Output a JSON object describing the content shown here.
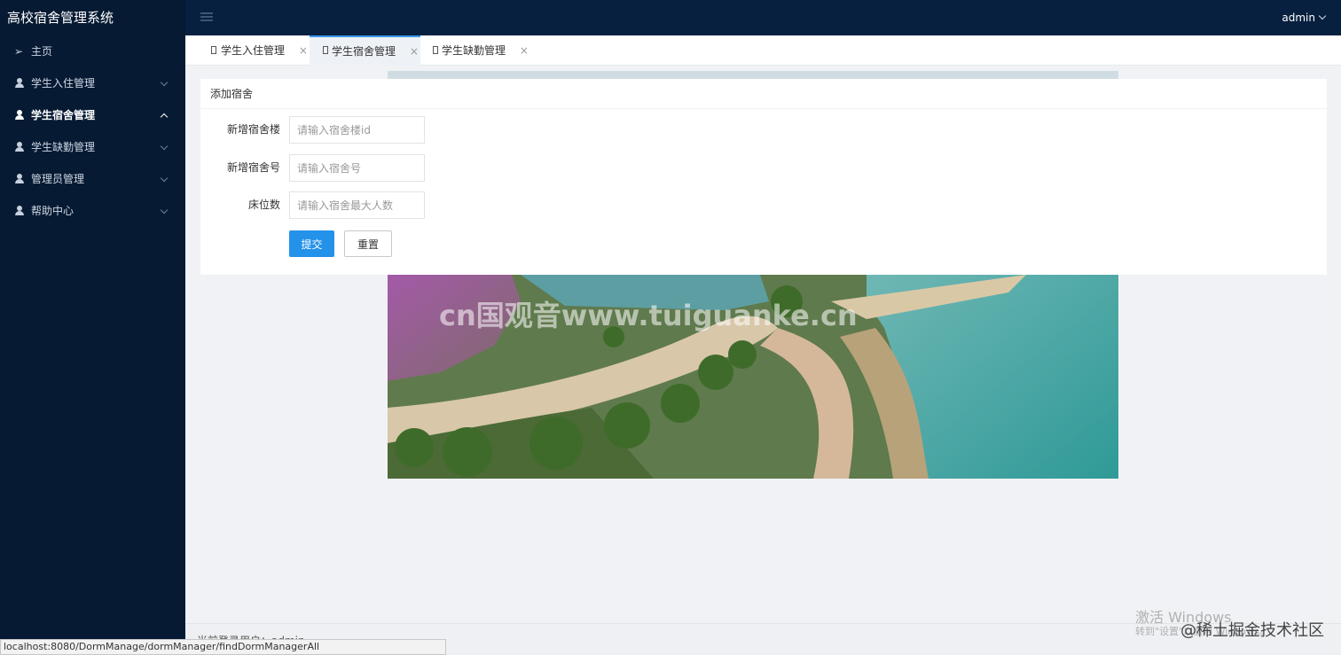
{
  "app": {
    "title": "高校宿舍管理系统"
  },
  "header": {
    "user": "admin"
  },
  "sidebar": {
    "items": [
      {
        "label": "主页",
        "icon": "paper-plane-icon"
      },
      {
        "label": "学生入住管理",
        "icon": "user-icon"
      },
      {
        "label": "学生宿舍管理",
        "icon": "user-icon"
      },
      {
        "label": "学生缺勤管理",
        "icon": "user-icon"
      },
      {
        "label": "管理员管理",
        "icon": "user-icon"
      },
      {
        "label": "帮助中心",
        "icon": "user-icon"
      }
    ]
  },
  "tabs": [
    {
      "label": "学生入住管理",
      "close": "×"
    },
    {
      "label": "学生宿舍管理",
      "close": "×"
    },
    {
      "label": "学生缺勤管理",
      "close": "×"
    }
  ],
  "form": {
    "title": "添加宿舍",
    "fields": [
      {
        "label": "新增宿舍楼",
        "placeholder": "请输入宿舍楼id"
      },
      {
        "label": "新增宿舍号",
        "placeholder": "请输入宿舍号"
      },
      {
        "label": "床位数",
        "placeholder": "请输入宿舍最大人数"
      }
    ],
    "submit_label": "提交",
    "reset_label": "重置"
  },
  "photo": {
    "watermark": "cn国观音www.tuiguanke.cn"
  },
  "footer": {
    "text": "当前登录用户：admin"
  },
  "status_bar": {
    "url": "localhost:8080/DormManage/dormManager/findDormManagerAll"
  },
  "overlay": {
    "activate_title": "激活 Windows",
    "activate_sub": "转到\"设置\"以激活 Windows。",
    "watermark": "@稀土掘金技术社区"
  },
  "colors": {
    "header_bg": "#07203f",
    "sidebar_bg": "#061a33",
    "accent": "#2592ea"
  }
}
